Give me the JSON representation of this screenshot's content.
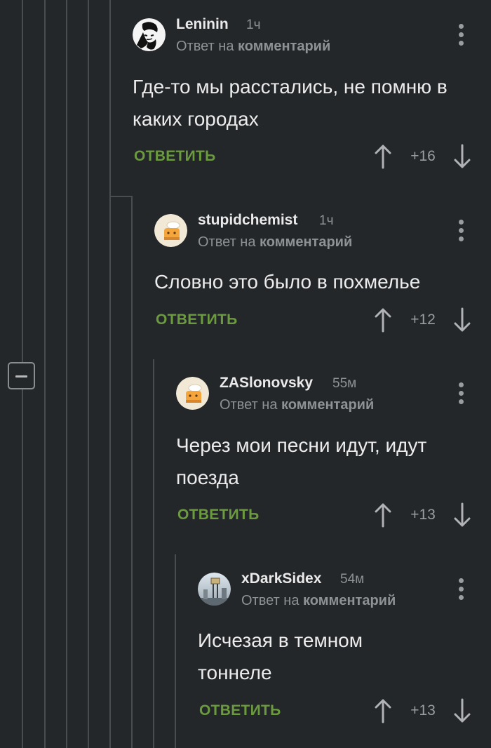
{
  "comments": [
    {
      "username": "Leninin",
      "time": "1ч",
      "reply_prefix": "Ответ на",
      "reply_link": "комментарий",
      "text": "Где-то мы расстались, не помню в каких городах",
      "reply_label": "ОТВЕТИТЬ",
      "rating": "+16"
    },
    {
      "username": "stupidchemist",
      "time": "1ч",
      "reply_prefix": "Ответ на",
      "reply_link": "комментарий",
      "text": "Словно это было в похмелье",
      "reply_label": "ОТВЕТИТЬ",
      "rating": "+12"
    },
    {
      "username": "ZASlonovsky",
      "time": "55м",
      "reply_prefix": "Ответ на",
      "reply_link": "комментарий",
      "text": "Через мои песни идут, идут поезда",
      "reply_label": "ОТВЕТИТЬ",
      "rating": "+13"
    },
    {
      "username": "xDarkSidex",
      "time": "54м",
      "reply_prefix": "Ответ на",
      "reply_link": "комментарий",
      "text": "Исчезая в темном тоннеле",
      "reply_label": "ОТВЕТИТЬ",
      "rating": "+13"
    }
  ],
  "icons": {
    "collapse": "minus-square-icon",
    "menu": "more-vertical-icon",
    "upvote": "arrow-up-icon",
    "downvote": "arrow-down-icon"
  },
  "colors": {
    "background": "#24272a",
    "reply_button": "#6b9a3f",
    "thread_line": "#4a4d50",
    "muted_text": "#8f9295"
  }
}
